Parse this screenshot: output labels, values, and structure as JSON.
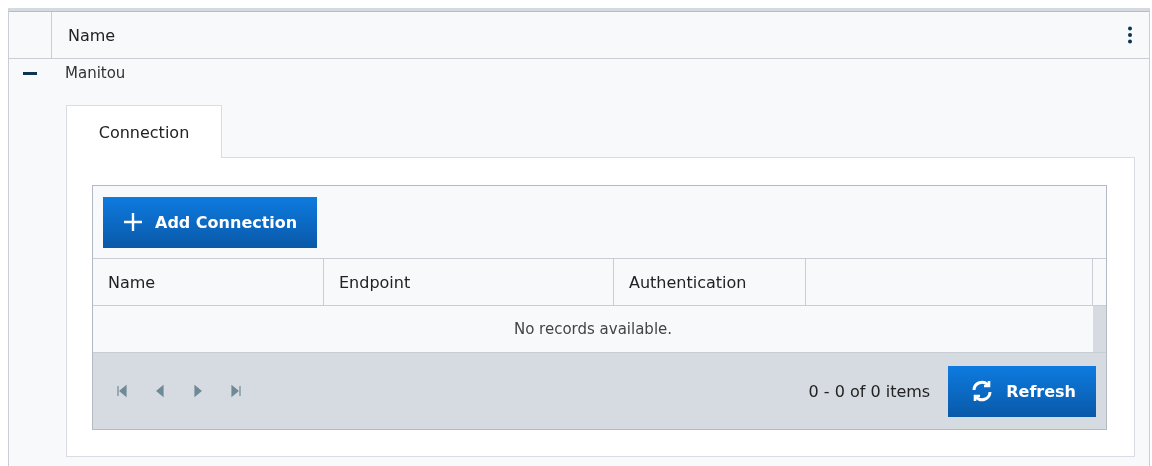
{
  "grid": {
    "columns": [
      {
        "label": "Name"
      }
    ],
    "rows": [
      {
        "name": "Manitou",
        "expanded": true,
        "tabs": [
          {
            "label": "Connection",
            "selected": true
          }
        ],
        "detail": {
          "add_button": "Add Connection",
          "columns": [
            {
              "label": "Name"
            },
            {
              "label": "Endpoint"
            },
            {
              "label": "Authentication"
            },
            {}
          ],
          "empty_message": "No records available.",
          "pager": {
            "info": "0 - 0 of 0 items",
            "refresh_button": "Refresh"
          }
        }
      }
    ]
  }
}
